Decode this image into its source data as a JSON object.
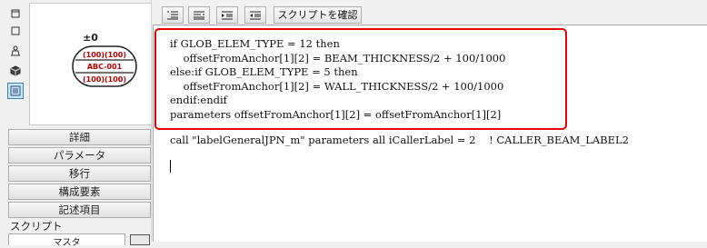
{
  "tools": [
    {
      "name": "window-icon"
    },
    {
      "name": "square-icon"
    },
    {
      "name": "person-3d-icon"
    },
    {
      "name": "cube-icon"
    },
    {
      "name": "list-view-icon"
    }
  ],
  "preview": {
    "elevation": "±0",
    "top_label": "(100)(100)",
    "mid_label": "ABC-001",
    "bottom_label": "(100)(100)"
  },
  "side_buttons": [
    "詳細",
    "パラメータ",
    "移行",
    "構成要素",
    "記述項目"
  ],
  "script_section": {
    "label": "スクリプト",
    "tab": "マスタ"
  },
  "toolbar": {
    "check_script": "スクリプトを確認"
  },
  "editor": {
    "highlighted_lines": [
      "if GLOB_ELEM_TYPE = 12 then",
      "    offsetFromAnchor[1][2] = BEAM_THICKNESS/2 + 100/1000",
      "else:if GLOB_ELEM_TYPE = 5 then",
      "    offsetFromAnchor[1][2] = WALL_THICKNESS/2 + 100/1000",
      "endif:endif",
      "parameters offsetFromAnchor[1][2] = offsetFromAnchor[1][2]"
    ],
    "call_line": "call \"labelGeneralJPN_m\" parameters all iCallerLabel = 2    ! CALLER_BEAM_LABEL2"
  }
}
